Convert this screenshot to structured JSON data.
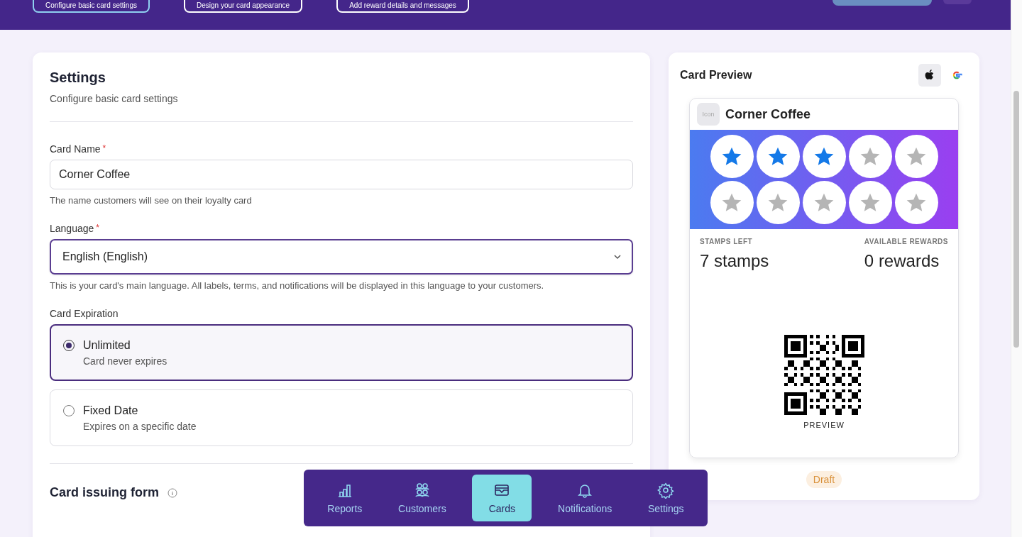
{
  "steps": [
    {
      "label": "Configure basic card settings",
      "selected": true
    },
    {
      "label": "Design your card appearance",
      "selected": false
    },
    {
      "label": "Add reward details and messages",
      "selected": false
    }
  ],
  "settings": {
    "title": "Settings",
    "subtitle": "Configure basic card settings",
    "card_name": {
      "label": "Card Name",
      "required_mark": "*",
      "value": "Corner Coffee",
      "help": "The name customers will see on their loyalty card"
    },
    "language": {
      "label": "Language",
      "required_mark": "*",
      "value": "English (English)",
      "help": "This is your card's main language. All labels, terms, and notifications will be displayed in this language to your customers."
    },
    "expiration": {
      "label": "Card Expiration",
      "options": [
        {
          "title": "Unlimited",
          "description": "Card never expires",
          "selected": true
        },
        {
          "title": "Fixed Date",
          "description": "Expires on a specific date",
          "selected": false
        }
      ]
    },
    "issuing_form": {
      "title": "Card issuing form"
    }
  },
  "preview": {
    "title": "Card Preview",
    "platforms": [
      {
        "kind": "apple",
        "selected": true
      },
      {
        "kind": "google",
        "selected": false
      }
    ],
    "card": {
      "icon_label": "Icon",
      "name": "Corner Coffee",
      "stamps": [
        {
          "filled": true
        },
        {
          "filled": true
        },
        {
          "filled": true
        },
        {
          "filled": false
        },
        {
          "filled": false
        },
        {
          "filled": false
        },
        {
          "filled": false
        },
        {
          "filled": false
        },
        {
          "filled": false
        },
        {
          "filled": false
        }
      ],
      "fields": [
        {
          "label": "STAMPS LEFT",
          "value": "7 stamps"
        },
        {
          "label": "AVAILABLE REWARDS",
          "value": "0 rewards"
        }
      ],
      "qr_caption": "PREVIEW"
    },
    "status": "Draft"
  },
  "nav": [
    {
      "kind": "reports",
      "label": "Reports",
      "selected": false
    },
    {
      "kind": "customers",
      "label": "Customers",
      "selected": false
    },
    {
      "kind": "cards",
      "label": "Cards",
      "selected": true
    },
    {
      "kind": "notifications",
      "label": "Notifications",
      "selected": false
    },
    {
      "kind": "settings",
      "label": "Settings",
      "selected": false
    }
  ]
}
